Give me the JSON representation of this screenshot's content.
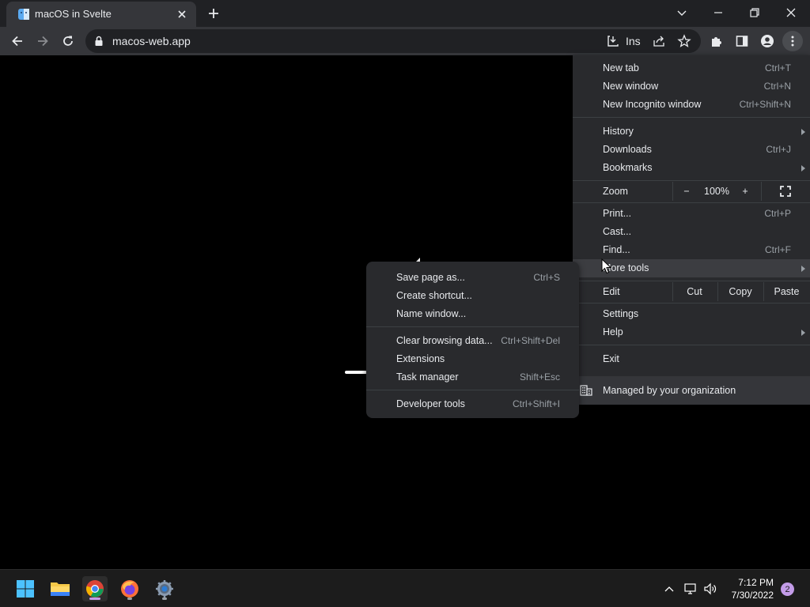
{
  "browser": {
    "tab_title": "macOS in Svelte",
    "url": "macos-web.app",
    "omnibox_badge": "Ins"
  },
  "main_menu": {
    "items": [
      {
        "label": "New tab",
        "shortcut": "Ctrl+T"
      },
      {
        "label": "New window",
        "shortcut": "Ctrl+N"
      },
      {
        "label": "New Incognito window",
        "shortcut": "Ctrl+Shift+N"
      },
      {
        "label": "History",
        "shortcut": ""
      },
      {
        "label": "Downloads",
        "shortcut": "Ctrl+J"
      },
      {
        "label": "Bookmarks",
        "shortcut": ""
      },
      {
        "label": "Print...",
        "shortcut": "Ctrl+P"
      },
      {
        "label": "Cast...",
        "shortcut": ""
      },
      {
        "label": "Find...",
        "shortcut": "Ctrl+F"
      },
      {
        "label": "More tools",
        "shortcut": ""
      },
      {
        "label": "Settings",
        "shortcut": ""
      },
      {
        "label": "Help",
        "shortcut": ""
      },
      {
        "label": "Exit",
        "shortcut": ""
      }
    ],
    "zoom": {
      "label": "Zoom",
      "minus": "−",
      "value": "100%",
      "plus": "+"
    },
    "edit": {
      "label": "Edit",
      "cut": "Cut",
      "copy": "Copy",
      "paste": "Paste"
    },
    "managed": "Managed by your organization"
  },
  "more_tools_menu": {
    "items": [
      {
        "label": "Save page as...",
        "shortcut": "Ctrl+S"
      },
      {
        "label": "Create shortcut...",
        "shortcut": ""
      },
      {
        "label": "Name window...",
        "shortcut": ""
      },
      {
        "label": "Clear browsing data...",
        "shortcut": "Ctrl+Shift+Del"
      },
      {
        "label": "Extensions",
        "shortcut": ""
      },
      {
        "label": "Task manager",
        "shortcut": "Shift+Esc"
      },
      {
        "label": "Developer tools",
        "shortcut": "Ctrl+Shift+I"
      }
    ]
  },
  "taskbar": {
    "time": "7:12 PM",
    "date": "7/30/2022",
    "notification_count": "2"
  },
  "colors": {
    "accent": "#c39ce8",
    "menu_bg": "#292a2d",
    "toolbar_bg": "#35363a",
    "tabstrip_bg": "#202124"
  }
}
